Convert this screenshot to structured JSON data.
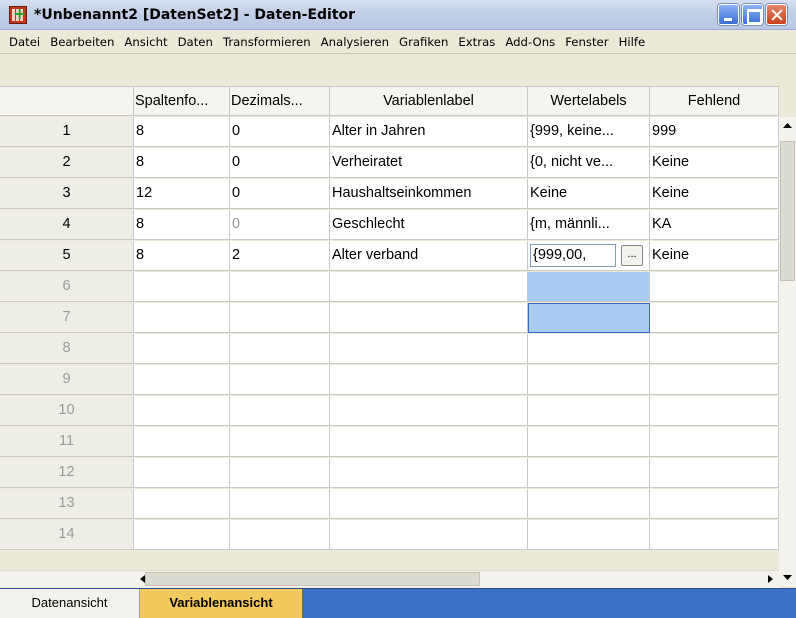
{
  "window": {
    "title": "*Unbenannt2 [DatenSet2] - Daten-Editor"
  },
  "menu": [
    "Datei",
    "Bearbeiten",
    "Ansicht",
    "Daten",
    "Transformieren",
    "Analysieren",
    "Grafiken",
    "Extras",
    "Add-Ons",
    "Fenster",
    "Hilfe"
  ],
  "columns": [
    "Spaltenfo...",
    "Dezimals...",
    "Variablenlabel",
    "Wertelabels",
    "Fehlend"
  ],
  "rows": [
    {
      "num": "1",
      "cells": [
        "8",
        "0",
        "Alter in Jahren",
        "{999, keine...",
        "999"
      ]
    },
    {
      "num": "2",
      "cells": [
        "8",
        "0",
        "Verheiratet",
        "{0, nicht ve...",
        "Keine"
      ]
    },
    {
      "num": "3",
      "cells": [
        "12",
        "0",
        "Haushaltseinkommen",
        "Keine",
        "Keine"
      ]
    },
    {
      "num": "4",
      "cells": [
        "8",
        "0",
        "Geschlecht",
        "{m, männli...",
        "KA"
      ]
    },
    {
      "num": "5",
      "cells": [
        "8",
        "2",
        "Alter verband",
        "{999,00,",
        "Keine"
      ]
    }
  ],
  "empty_rows": [
    "6",
    "7",
    "8",
    "9",
    "10",
    "11",
    "12",
    "13",
    "14"
  ],
  "ellipsis_label": "...",
  "tabs": {
    "data_view": "Datenansicht",
    "variable_view": "Variablenansicht"
  },
  "colors": {
    "selection": "#a9cdf0",
    "active_tab": "#f2c95c",
    "tab_bar": "#3c6fc6"
  }
}
